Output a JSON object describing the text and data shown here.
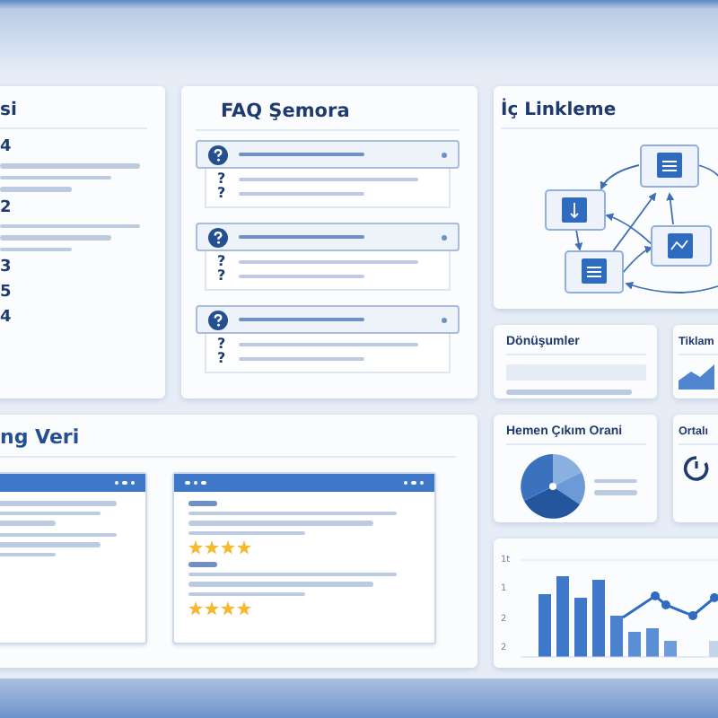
{
  "schema_card": {
    "title": "si",
    "items": [
      {
        "kind": "block",
        "label": "4"
      },
      {
        "kind": "block",
        "label": "2"
      },
      {
        "kind": "plain",
        "label": "3"
      },
      {
        "kind": "plain",
        "label": "5"
      },
      {
        "kind": "plain",
        "label": "4"
      }
    ]
  },
  "faq_card": {
    "title": "FAQ Şemora",
    "questions": [
      {
        "expanded": true,
        "marks": [
          "?",
          "?"
        ]
      },
      {
        "expanded": true,
        "marks": [
          "?",
          "?"
        ]
      },
      {
        "expanded": true,
        "marks": [
          "?",
          "?"
        ]
      }
    ]
  },
  "links_card": {
    "title": "İç Linkleme"
  },
  "metrics": [
    {
      "kind": "bar",
      "title": "Dönüşumler"
    },
    {
      "kind": "area",
      "title": "Tiklam"
    },
    {
      "kind": "pie",
      "title": "Hemen Çıkım Orani"
    },
    {
      "kind": "timer",
      "title": "Ortalı"
    }
  ],
  "chart_card": {
    "axis_labels": [
      "1t",
      "1",
      "2",
      "2"
    ]
  },
  "structured_data": {
    "title": "ng Veri",
    "windows": [
      {
        "rows": [
          {
            "heading": false
          },
          {
            "heading": false
          }
        ]
      },
      {
        "left_dots": true,
        "rows": [
          {
            "heading": true,
            "stars": 4
          },
          {
            "heading": true,
            "stars": 4
          }
        ]
      }
    ]
  }
}
